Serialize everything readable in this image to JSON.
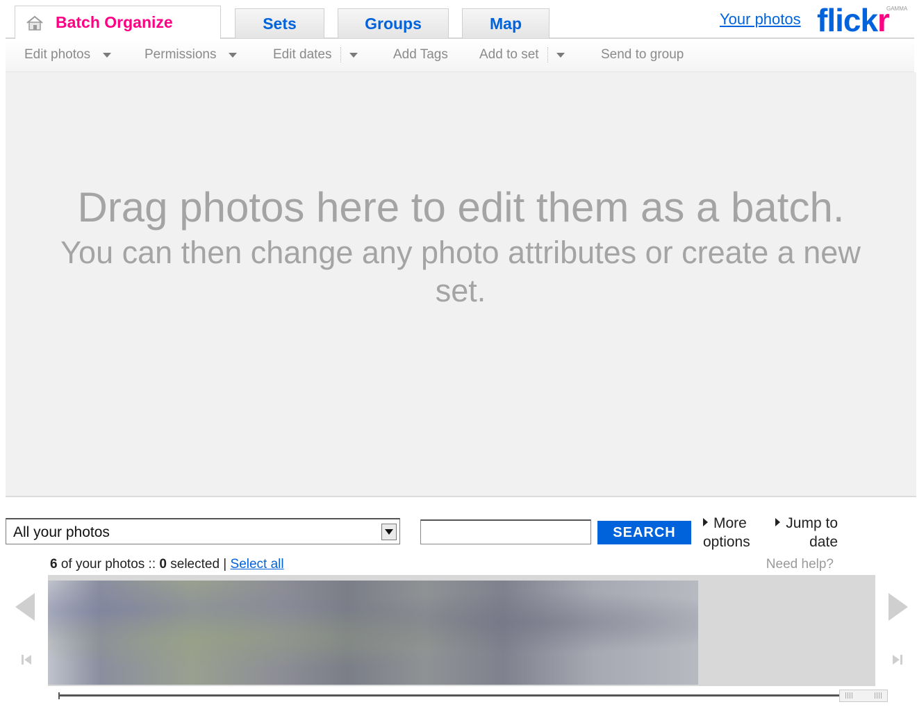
{
  "tabs": {
    "batch_organize": "Batch Organize",
    "sets": "Sets",
    "groups": "Groups",
    "map": "Map"
  },
  "header": {
    "your_photos": "Your photos",
    "logo_part1": "flick",
    "logo_part2": "r",
    "logo_badge": "GAMMA"
  },
  "toolbar": {
    "edit_photos": "Edit photos",
    "permissions": "Permissions",
    "edit_dates": "Edit dates",
    "add_tags": "Add Tags",
    "add_to_set": "Add to set",
    "send_to_group": "Send to group"
  },
  "batch_area": {
    "line1": "Drag photos here to edit them as a batch.",
    "line2": "You can then change any photo attributes or create a new set."
  },
  "filmstrip": {
    "source_select": "All your photos",
    "search_value": "",
    "search_button": "SEARCH",
    "more_options_1": "More",
    "more_options_2": "options",
    "jump_to_date_1": "Jump to",
    "jump_to_date_2": "date",
    "count_number": "6",
    "count_suffix": "of your photos ::",
    "selected_number": "0",
    "selected_suffix": "selected |",
    "select_all": "Select all",
    "need_help": "Need help?"
  },
  "colors": {
    "flickr_blue": "#0063dc",
    "flickr_pink": "#ff0084",
    "batch_bg": "#f1f1f1"
  }
}
